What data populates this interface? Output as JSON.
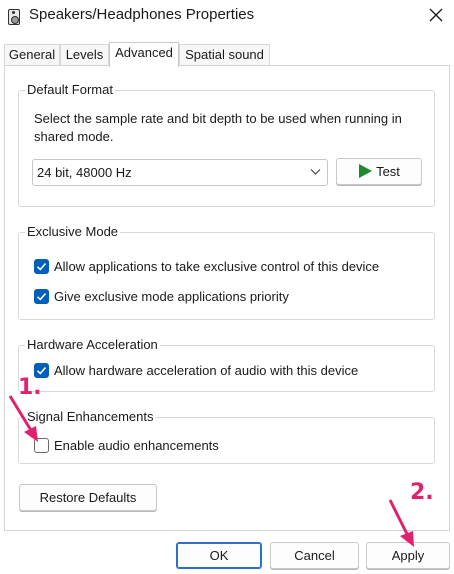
{
  "window": {
    "title": "Speakers/Headphones Properties"
  },
  "tabs": [
    {
      "label": "General",
      "active": false
    },
    {
      "label": "Levels",
      "active": false
    },
    {
      "label": "Advanced",
      "active": true
    },
    {
      "label": "Spatial sound",
      "active": false
    }
  ],
  "default_format": {
    "title": "Default Format",
    "description": "Select the sample rate and bit depth to be used when running in shared mode.",
    "selected_format": "24 bit, 48000 Hz",
    "test_label": "Test"
  },
  "exclusive_mode": {
    "title": "Exclusive Mode",
    "options": [
      {
        "label": "Allow applications to take exclusive control of this device",
        "checked": true
      },
      {
        "label": "Give exclusive mode applications priority",
        "checked": true
      }
    ]
  },
  "hardware_acceleration": {
    "title": "Hardware Acceleration",
    "option": {
      "label": "Allow hardware acceleration of audio with this device",
      "checked": true
    }
  },
  "signal_enhancements": {
    "title": "Signal Enhancements",
    "option": {
      "label": "Enable audio enhancements",
      "checked": false
    }
  },
  "buttons": {
    "restore_defaults": "Restore Defaults",
    "ok": "OK",
    "cancel": "Cancel",
    "apply": "Apply"
  },
  "annotations": {
    "step1": "1.",
    "step2": "2."
  },
  "colors": {
    "accent": "#005fb8",
    "annotation": "#e0226e",
    "test_icon": "#1e8a2e"
  },
  "icons": {
    "app": "speaker-icon",
    "close": "close-icon",
    "dropdown": "chevron-down-icon",
    "test": "play-icon",
    "check": "checkmark-icon"
  }
}
